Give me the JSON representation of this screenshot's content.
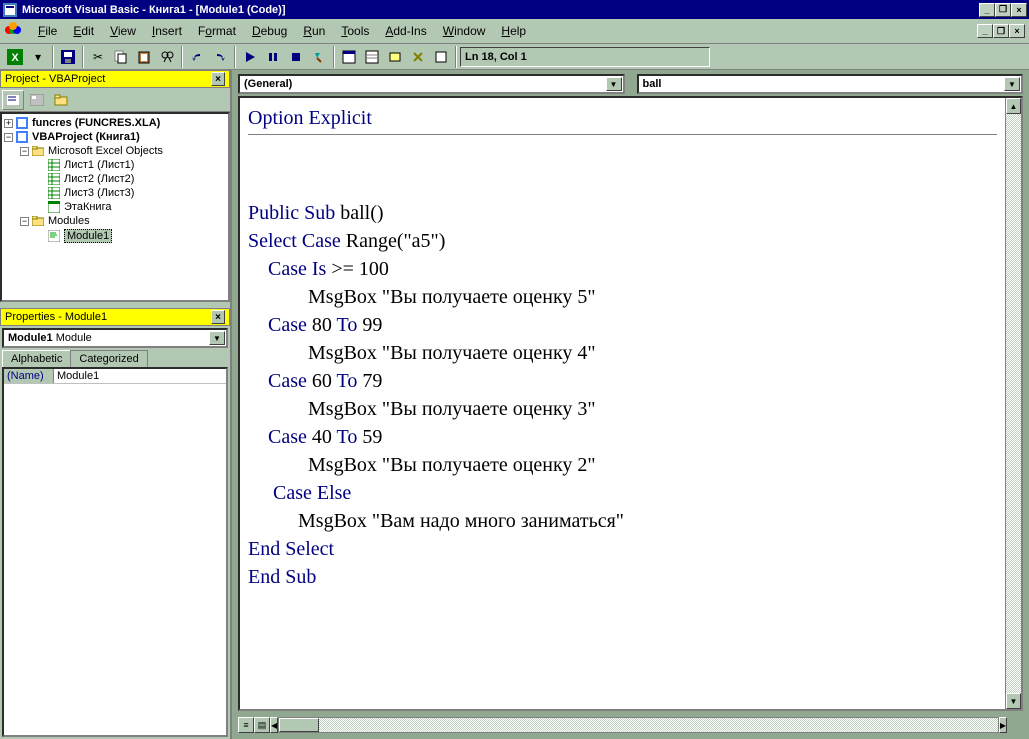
{
  "titlebar": {
    "title": "Microsoft Visual Basic - Книга1 - [Module1 (Code)]"
  },
  "menubar": {
    "items": [
      {
        "label": "File",
        "u": 0
      },
      {
        "label": "Edit",
        "u": 0
      },
      {
        "label": "View",
        "u": 0
      },
      {
        "label": "Insert",
        "u": 0
      },
      {
        "label": "Format",
        "u": 1
      },
      {
        "label": "Debug",
        "u": 0
      },
      {
        "label": "Run",
        "u": 0
      },
      {
        "label": "Tools",
        "u": 0
      },
      {
        "label": "Add-Ins",
        "u": 0
      },
      {
        "label": "Window",
        "u": 0
      },
      {
        "label": "Help",
        "u": 0
      }
    ]
  },
  "toolbar": {
    "position": "Ln 18, Col 1"
  },
  "project_panel": {
    "title": "Project - VBAProject",
    "tree": [
      {
        "indent": 0,
        "exp": "+",
        "icon": "vba",
        "label": "funcres (FUNCRES.XLA)",
        "bold": true
      },
      {
        "indent": 0,
        "exp": "-",
        "icon": "vba",
        "label": "VBAProject (Книга1)",
        "bold": true
      },
      {
        "indent": 1,
        "exp": "-",
        "icon": "folder",
        "label": "Microsoft Excel Objects"
      },
      {
        "indent": 2,
        "exp": "",
        "icon": "sheet",
        "label": "Лист1 (Лист1)"
      },
      {
        "indent": 2,
        "exp": "",
        "icon": "sheet",
        "label": "Лист2 (Лист2)"
      },
      {
        "indent": 2,
        "exp": "",
        "icon": "sheet",
        "label": "Лист3 (Лист3)"
      },
      {
        "indent": 2,
        "exp": "",
        "icon": "book",
        "label": "ЭтаКнига"
      },
      {
        "indent": 1,
        "exp": "-",
        "icon": "folder",
        "label": "Modules"
      },
      {
        "indent": 2,
        "exp": "",
        "icon": "module",
        "label": "Module1",
        "selected": true
      }
    ]
  },
  "properties_panel": {
    "title": "Properties - Module1",
    "object": "Module1",
    "object_type": "Module",
    "tabs": [
      "Alphabetic",
      "Categorized"
    ],
    "rows": [
      {
        "name": "(Name)",
        "value": "Module1"
      }
    ]
  },
  "code": {
    "object_selector": "(General)",
    "proc_selector": "ball",
    "lines": [
      {
        "t": "kw",
        "s": "Option Explicit"
      },
      {
        "t": "hr"
      },
      {
        "t": "blank"
      },
      {
        "t": "blank"
      },
      {
        "t": "mix",
        "parts": [
          {
            "k": true,
            "s": "Public Sub "
          },
          {
            "k": false,
            "s": "ball()"
          }
        ]
      },
      {
        "t": "mix",
        "parts": [
          {
            "k": true,
            "s": "Select Case "
          },
          {
            "k": false,
            "s": "Range(\"a5\")"
          }
        ]
      },
      {
        "t": "mix",
        "indent": 1,
        "parts": [
          {
            "k": true,
            "s": "Case Is "
          },
          {
            "k": false,
            "s": ">= 100"
          }
        ]
      },
      {
        "t": "plain",
        "indent": 3,
        "s": "MsgBox \"Вы получаете оценку 5\""
      },
      {
        "t": "mix",
        "indent": 1,
        "parts": [
          {
            "k": true,
            "s": "Case "
          },
          {
            "k": false,
            "s": "80 "
          },
          {
            "k": true,
            "s": "To "
          },
          {
            "k": false,
            "s": "99"
          }
        ]
      },
      {
        "t": "plain",
        "indent": 3,
        "s": "MsgBox \"Вы получаете оценку 4\""
      },
      {
        "t": "mix",
        "indent": 1,
        "parts": [
          {
            "k": true,
            "s": "Case "
          },
          {
            "k": false,
            "s": "60 "
          },
          {
            "k": true,
            "s": "To "
          },
          {
            "k": false,
            "s": "79"
          }
        ]
      },
      {
        "t": "plain",
        "indent": 3,
        "s": "MsgBox \"Вы получаете оценку 3\""
      },
      {
        "t": "mix",
        "indent": 1,
        "parts": [
          {
            "k": true,
            "s": "Case "
          },
          {
            "k": false,
            "s": "40 "
          },
          {
            "k": true,
            "s": "To "
          },
          {
            "k": false,
            "s": "59"
          }
        ]
      },
      {
        "t": "plain",
        "indent": 3,
        "s": "MsgBox \"Вы получаете оценку 2\""
      },
      {
        "t": "kw",
        "indent": 1,
        "s": " Case Else"
      },
      {
        "t": "plain",
        "indent": 2,
        "s": "  MsgBox \"Вам надо много заниматься\""
      },
      {
        "t": "kw",
        "s": "End Select"
      },
      {
        "t": "kw",
        "s": "End Sub"
      }
    ]
  }
}
